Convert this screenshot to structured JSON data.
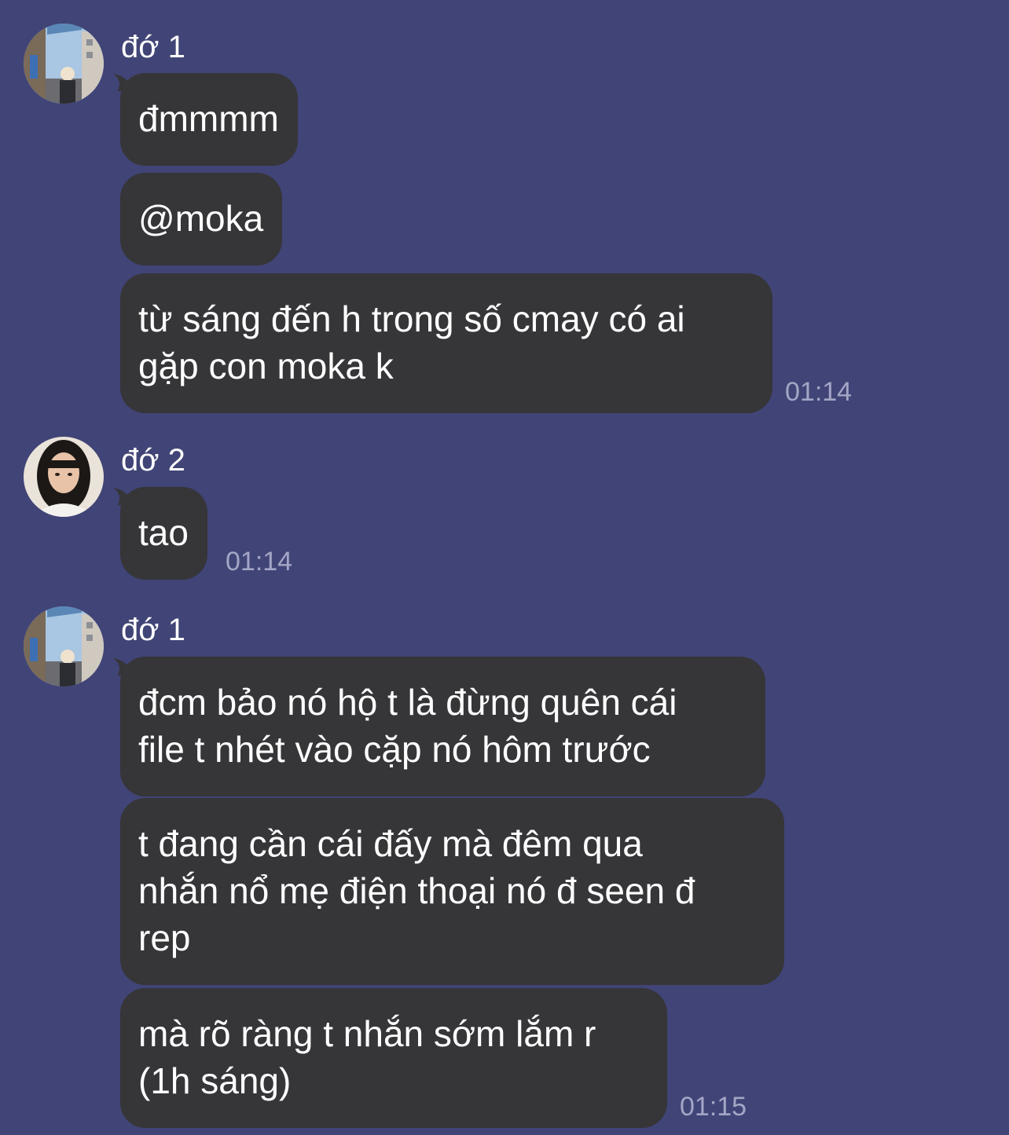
{
  "chat": {
    "groups": [
      {
        "sender": "đớ 1",
        "avatar_icon": "avatar-street-photo",
        "messages": [
          {
            "text": "đmmmm"
          },
          {
            "text": "@moka"
          },
          {
            "text": "từ sáng đến h trong số cmay có ai\ngặp con moka k",
            "time": "01:14"
          }
        ]
      },
      {
        "sender": "đớ 2",
        "avatar_icon": "avatar-portrait-photo",
        "messages": [
          {
            "text": "tao",
            "time": "01:14"
          }
        ]
      },
      {
        "sender": "đớ 1",
        "avatar_icon": "avatar-street-photo",
        "messages": [
          {
            "text": "đcm bảo nó hộ t là đừng quên cái\nfile t nhét vào cặp nó hôm trước"
          },
          {
            "text": "t đang cần cái đấy mà đêm qua\nnhắn nổ mẹ điện thoại nó đ seen đ\nrep"
          },
          {
            "text": "mà rõ ràng t nhắn sớm lắm r\n(1h sáng)",
            "time": "01:15"
          }
        ]
      }
    ]
  },
  "colors": {
    "background": "#414476",
    "bubble": "#363538",
    "text": "#ffffff",
    "timestamp": "#a4a6c6"
  }
}
